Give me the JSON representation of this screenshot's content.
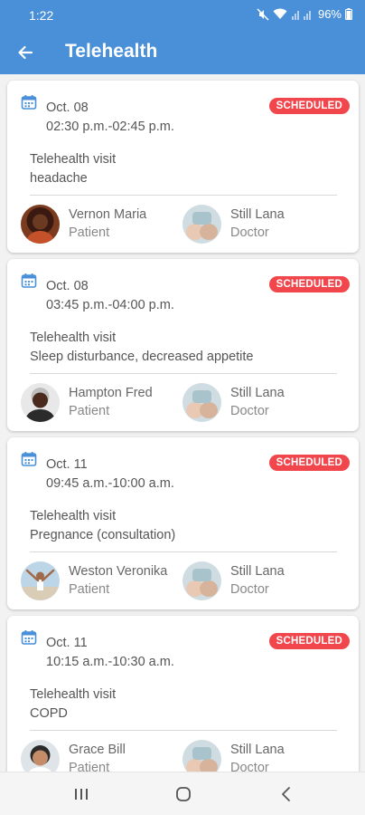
{
  "status_bar": {
    "time": "1:22",
    "battery": "96%"
  },
  "app_bar": {
    "title": "Telehealth"
  },
  "appointments": [
    {
      "date": "Oct. 08",
      "time": "02:30 p.m.-02:45 p.m.",
      "status": "SCHEDULED",
      "visit_type": "Telehealth visit",
      "reason": "headache",
      "patient": {
        "name": "Vernon Maria",
        "role": "Patient"
      },
      "doctor": {
        "name": "Still Lana",
        "role": "Doctor"
      }
    },
    {
      "date": "Oct. 08",
      "time": "03:45 p.m.-04:00 p.m.",
      "status": "SCHEDULED",
      "visit_type": "Telehealth visit",
      "reason": "Sleep disturbance, decreased appetite",
      "patient": {
        "name": "Hampton Fred",
        "role": "Patient"
      },
      "doctor": {
        "name": "Still Lana",
        "role": "Doctor"
      }
    },
    {
      "date": "Oct. 11",
      "time": "09:45 a.m.-10:00 a.m.",
      "status": "SCHEDULED",
      "visit_type": "Telehealth visit",
      "reason": "Pregnance (consultation)",
      "patient": {
        "name": "Weston Veronika",
        "role": "Patient"
      },
      "doctor": {
        "name": "Still Lana",
        "role": "Doctor"
      }
    },
    {
      "date": "Oct. 11",
      "time": "10:15 a.m.-10:30 a.m.",
      "status": "SCHEDULED",
      "visit_type": "Telehealth visit",
      "reason": "COPD",
      "patient": {
        "name": "Grace Bill",
        "role": "Patient"
      },
      "doctor": {
        "name": "Still Lana",
        "role": "Doctor"
      }
    }
  ],
  "colors": {
    "primary": "#4a90d9",
    "badge": "#f0464c",
    "card_bg": "#ffffff",
    "page_bg": "#f2f2f2"
  },
  "icons": {
    "back": "arrow-left-icon",
    "calendar": "calendar-icon",
    "nav_recents": "recent-apps-icon",
    "nav_home": "home-icon",
    "nav_back": "back-chevron-icon"
  }
}
